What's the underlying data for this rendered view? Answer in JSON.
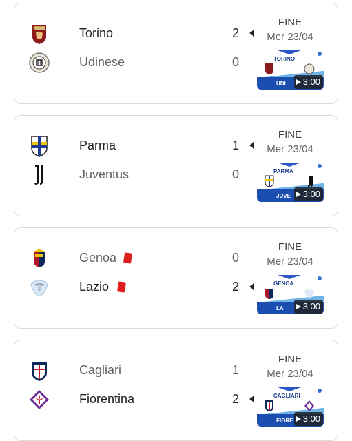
{
  "matches": [
    {
      "home": {
        "name": "Torino",
        "score": "2",
        "icon": "torino-crest-icon",
        "winner": true
      },
      "away": {
        "name": "Udinese",
        "score": "0",
        "icon": "udinese-crest-icon",
        "winner": false
      },
      "status": "FINE",
      "date": "Mer 23/04",
      "thumbnail": {
        "title": "TORINO",
        "subtitle": "UDI",
        "duration": "3:00"
      }
    },
    {
      "home": {
        "name": "Parma",
        "score": "1",
        "icon": "parma-crest-icon",
        "winner": true
      },
      "away": {
        "name": "Juventus",
        "score": "0",
        "icon": "juventus-crest-icon",
        "winner": false
      },
      "status": "FINE",
      "date": "Mer 23/04",
      "thumbnail": {
        "title": "PARMA",
        "subtitle": "JUVE",
        "duration": "3:00"
      }
    },
    {
      "home": {
        "name": "Genoa",
        "score": "0",
        "icon": "genoa-crest-icon",
        "winner": false,
        "red_card": true
      },
      "away": {
        "name": "Lazio",
        "score": "2",
        "icon": "lazio-crest-icon",
        "winner": true,
        "red_card": true
      },
      "status": "FINE",
      "date": "Mer 23/04",
      "thumbnail": {
        "title": "GENOA",
        "subtitle": "LA",
        "duration": "3:00"
      }
    },
    {
      "home": {
        "name": "Cagliari",
        "score": "1",
        "icon": "cagliari-crest-icon",
        "winner": false
      },
      "away": {
        "name": "Fiorentina",
        "score": "2",
        "icon": "fiorentina-crest-icon",
        "winner": true
      },
      "status": "FINE",
      "date": "Mer 23/04",
      "thumbnail": {
        "title": "CAGLIARI",
        "subtitle": "FIORE",
        "duration": "3:00"
      }
    }
  ],
  "colors": {
    "red_card": "#e01e1e",
    "thumb_blue": "#1a4fb0",
    "border": "#dadce0"
  }
}
